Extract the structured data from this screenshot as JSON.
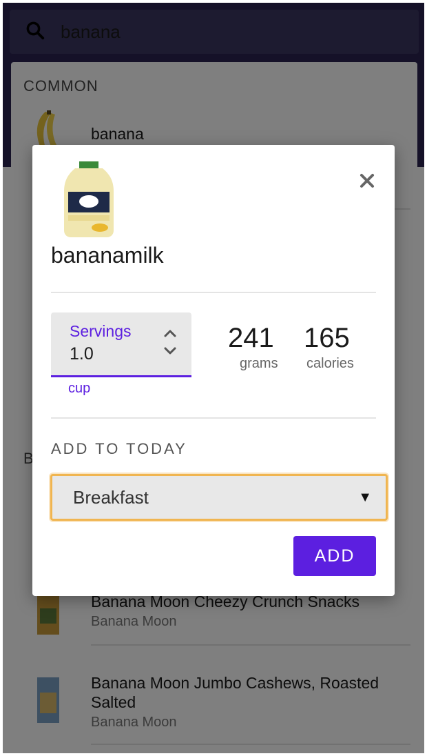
{
  "search": {
    "query": "banana"
  },
  "results": {
    "common_label": "COMMON",
    "branded_label_partial": "B",
    "common_items": [
      {
        "name": "banana"
      }
    ],
    "branded_items": [
      {
        "name": "Banana Moon Cheezy Crunch Snacks",
        "brand": "Banana Moon"
      },
      {
        "name": "Banana Moon Jumbo Cashews, Roasted Salted",
        "brand": "Banana Moon"
      }
    ]
  },
  "dialog": {
    "product_name": "bananamilk",
    "servings_label": "Servings",
    "servings_value": "1.0",
    "unit": "cup",
    "grams_value": "241",
    "grams_label": "grams",
    "calories_value": "165",
    "calories_label": "calories",
    "add_to_today_label": "ADD TO TODAY",
    "meal_selected": "Breakfast",
    "add_button": "ADD"
  },
  "colors": {
    "accent": "#5c1fe0",
    "header": "#2a2350",
    "focus_ring": "#f0b550"
  },
  "icons": [
    "search-icon",
    "close-icon",
    "chevron-up-icon",
    "chevron-down-icon",
    "dropdown-caret-icon"
  ]
}
